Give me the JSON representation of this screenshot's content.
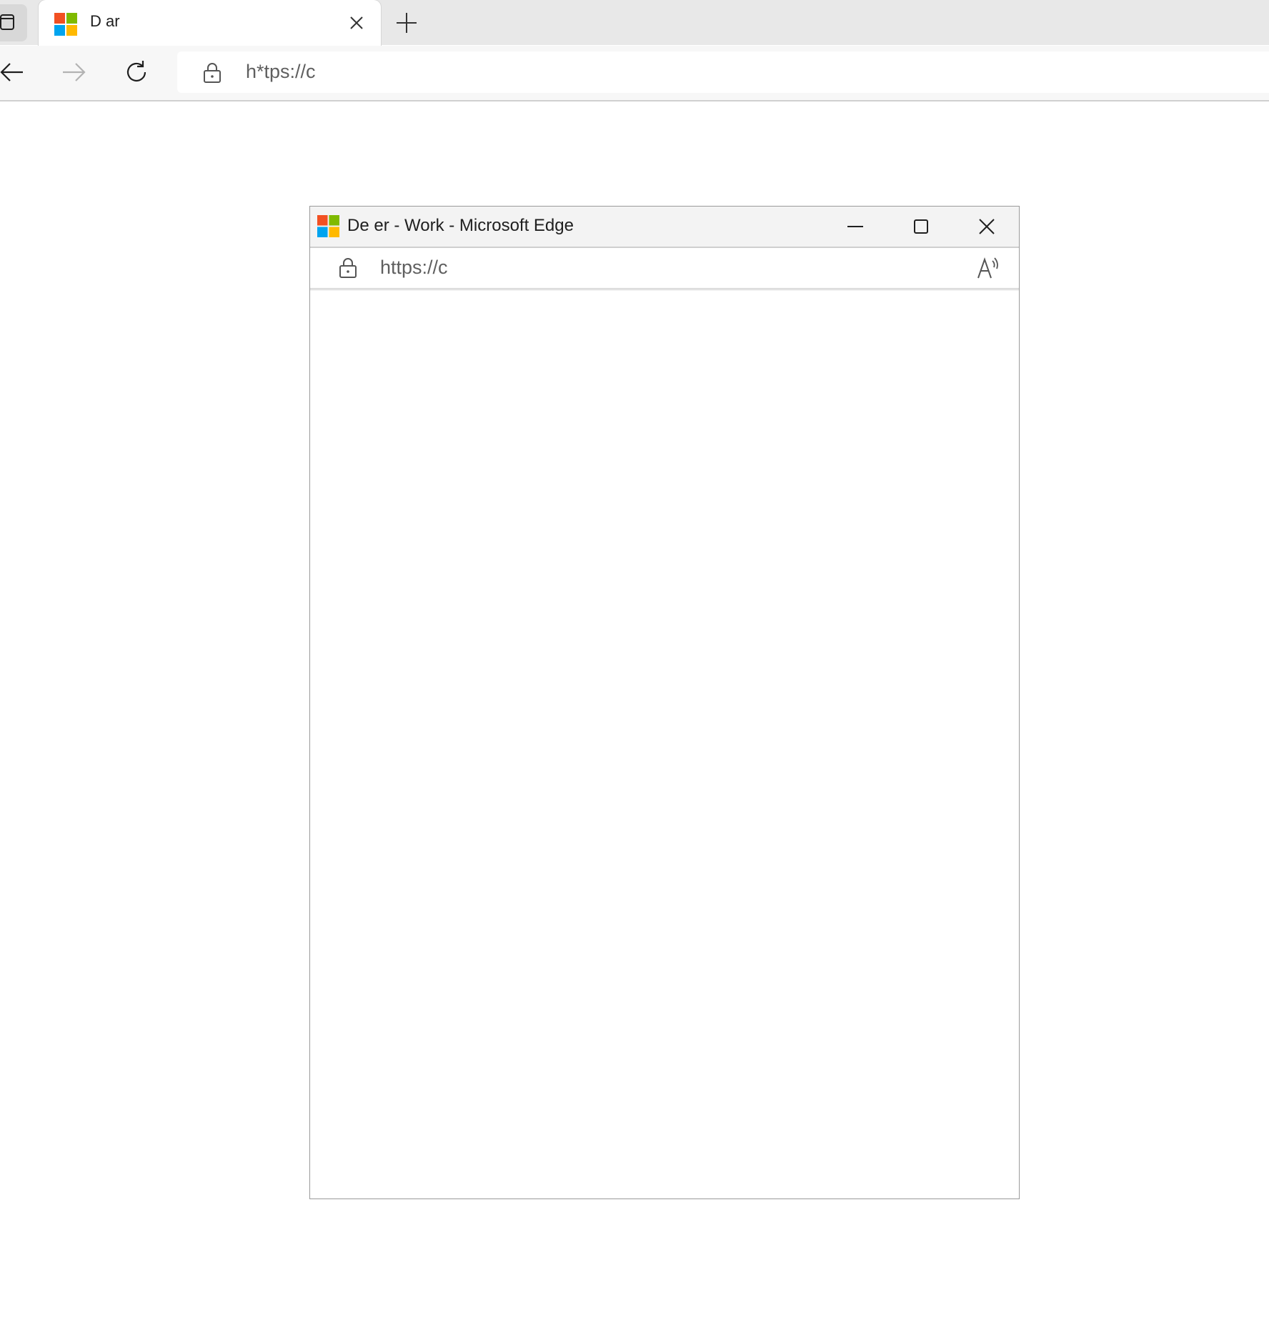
{
  "browser": {
    "tab": {
      "title": "D                 ar",
      "favicon": "microsoft-logo"
    },
    "toolbar": {
      "back_icon": "arrow-left-icon",
      "forward_icon": "arrow-right-icon",
      "refresh_icon": "refresh-icon",
      "address": "h*tps://c"
    }
  },
  "popup": {
    "title": "De                  er - Work - Microsoft Edge",
    "address": "https://c",
    "icons": {
      "minimize": "minimize-icon",
      "maximize": "maximize-icon",
      "close": "close-icon",
      "read_aloud": "read-aloud-icon"
    }
  },
  "colors": {
    "ms_red": "#f25022",
    "ms_green": "#7fba00",
    "ms_blue": "#00a4ef",
    "ms_yellow": "#ffb900",
    "tab_strip": "#e8e8e8",
    "toolbar": "#f7f7f7"
  }
}
